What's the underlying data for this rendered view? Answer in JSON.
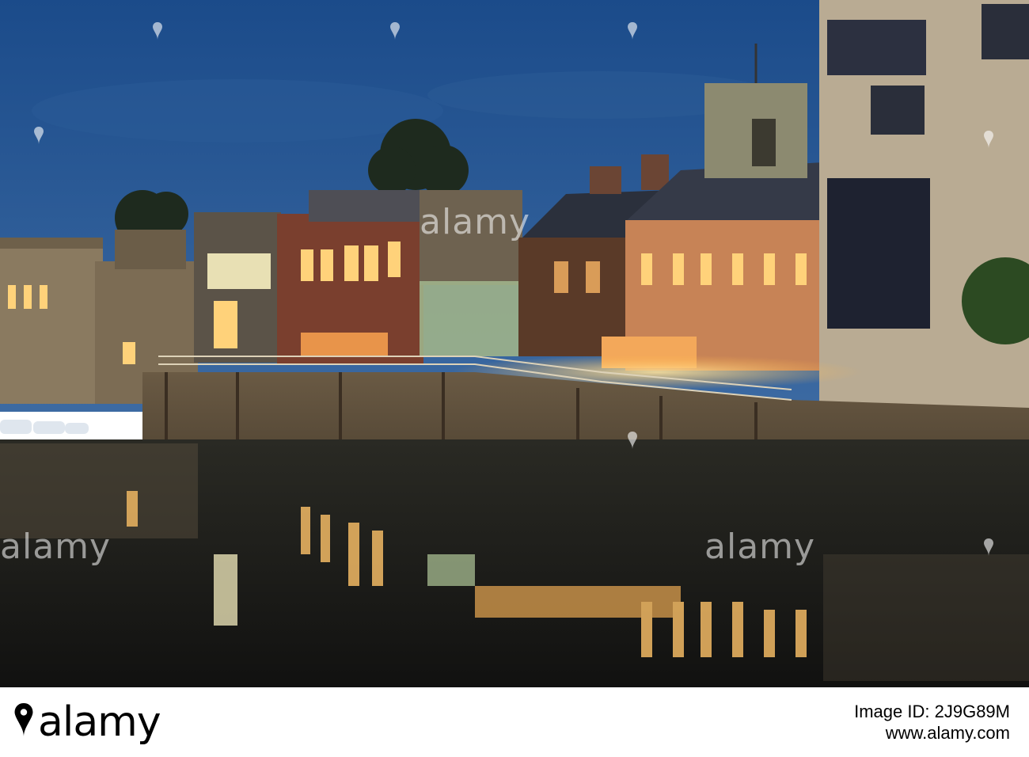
{
  "watermark": {
    "logo_text": "alamy",
    "pin_icon": "alamy-pin-icon"
  },
  "footer": {
    "brand": "alamy",
    "image_id_label": "Image ID:",
    "image_id": "2J9G89M",
    "site": "www.alamy.com"
  },
  "colors": {
    "sky_top": "#1f4f8e",
    "sky_bottom": "#3a6aa3",
    "water": "#1a1a18",
    "lamp_glow": "#ffd27a",
    "brick": "#9a4a32"
  }
}
